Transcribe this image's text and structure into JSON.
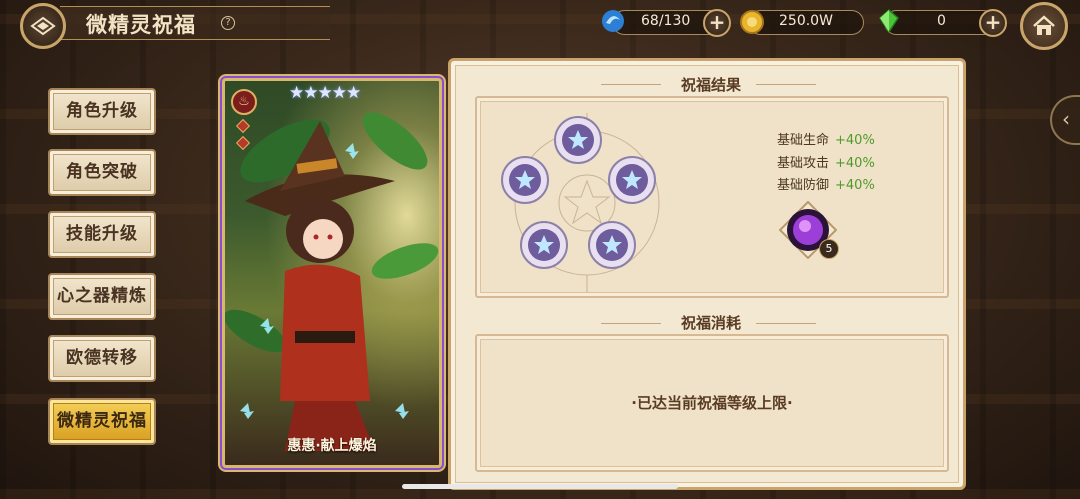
{
  "header": {
    "title": "微精灵祝福",
    "help_symbol": "?"
  },
  "resources": {
    "stamina": {
      "value": "68/130",
      "icon": "blue-swirl-icon"
    },
    "gold": {
      "value": "250.0W",
      "icon": "gold-coin-icon"
    },
    "gems": {
      "value": "0",
      "icon": "green-crystal-icon"
    },
    "plus_symbol": "+"
  },
  "sidebar": {
    "items": [
      {
        "label": "角色升级"
      },
      {
        "label": "角色突破"
      },
      {
        "label": "技能升级"
      },
      {
        "label": "心之器精炼"
      },
      {
        "label": "欧德转移"
      },
      {
        "label": "微精灵祝福",
        "active": true
      }
    ]
  },
  "character": {
    "name": "惠惠·献上爆焰",
    "stars": "★★★★★",
    "element_symbol": "♨"
  },
  "blessing_result": {
    "title": "祝福结果",
    "stats": [
      {
        "label": "基础生命",
        "value": "+40%"
      },
      {
        "label": "基础攻击",
        "value": "+40%"
      },
      {
        "label": "基础防御",
        "value": "+40%"
      }
    ],
    "item_count": "5"
  },
  "blessing_cost": {
    "title": "祝福消耗",
    "message": "·已达当前祝福等级上限·"
  },
  "colors": {
    "active_tab": "#e3b33a",
    "stat_positive": "#4f9a2a",
    "panel_bg": "#f3e9d3"
  }
}
